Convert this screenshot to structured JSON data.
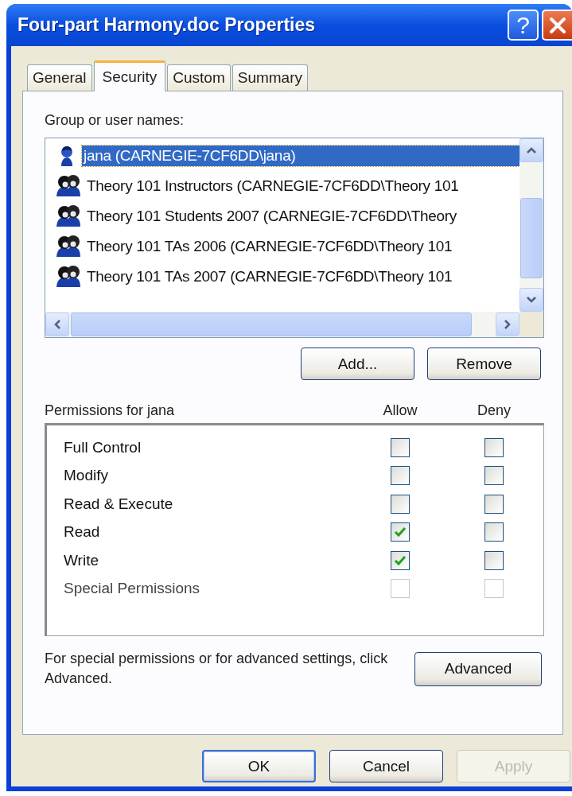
{
  "window": {
    "title": "Four-part Harmony.doc Properties"
  },
  "help_button": {
    "label": "?"
  },
  "tabs": [
    {
      "label": "General",
      "selected": false
    },
    {
      "label": "Security",
      "selected": true
    },
    {
      "label": "Custom",
      "selected": false
    },
    {
      "label": "Summary",
      "selected": false
    }
  ],
  "groups": {
    "label": "Group or user names:",
    "items": [
      {
        "name": "jana (CARNEGIE-7CF6DD\\jana)",
        "kind": "user",
        "selected": true
      },
      {
        "name": "Theory 101 Instructors (CARNEGIE-7CF6DD\\Theory 101",
        "kind": "group",
        "selected": false
      },
      {
        "name": "Theory 101 Students 2007 (CARNEGIE-7CF6DD\\Theory",
        "kind": "group",
        "selected": false
      },
      {
        "name": "Theory 101 TAs 2006 (CARNEGIE-7CF6DD\\Theory 101",
        "kind": "group",
        "selected": false
      },
      {
        "name": "Theory 101 TAs 2007 (CARNEGIE-7CF6DD\\Theory 101",
        "kind": "group",
        "selected": false
      }
    ]
  },
  "group_buttons": [
    "Add...",
    "Remove"
  ],
  "permissions": {
    "label": "Permissions for jana",
    "columns": [
      "Allow",
      "Deny"
    ],
    "rows": [
      {
        "name": "Full Control",
        "disabled": false,
        "allow": false,
        "deny": false
      },
      {
        "name": "Modify",
        "disabled": false,
        "allow": false,
        "deny": false
      },
      {
        "name": "Read & Execute",
        "disabled": false,
        "allow": false,
        "deny": false
      },
      {
        "name": "Read",
        "disabled": false,
        "allow": true,
        "deny": false
      },
      {
        "name": "Write",
        "disabled": false,
        "allow": true,
        "deny": false
      },
      {
        "name": "Special Permissions",
        "disabled": true,
        "allow": false,
        "deny": false
      }
    ]
  },
  "advanced": {
    "note": "For special permissions or for advanced settings, click Advanced.",
    "button": "Advanced"
  },
  "dialog_buttons": [
    {
      "label": "OK",
      "default": true,
      "disabled": false
    },
    {
      "label": "Cancel",
      "default": false,
      "disabled": false
    },
    {
      "label": "Apply",
      "default": false,
      "disabled": true
    }
  ]
}
